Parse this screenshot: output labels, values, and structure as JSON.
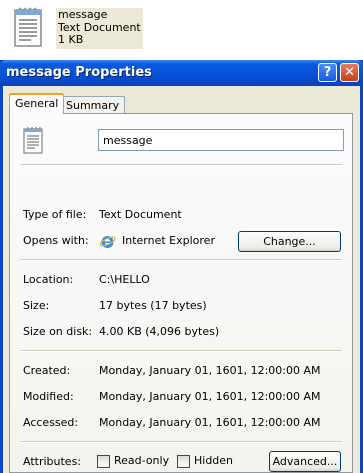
{
  "desktop_icon": {
    "name": "message",
    "type": "Text Document",
    "size": "1 KB"
  },
  "window": {
    "title": "message Properties",
    "help_button": "?",
    "close_button": "✕"
  },
  "tabs": [
    {
      "label": "General",
      "active": true
    },
    {
      "label": "Summary",
      "active": false
    }
  ],
  "general": {
    "file_name": "message",
    "type_of_file_label": "Type of file:",
    "type_of_file_value": "Text Document",
    "opens_with_label": "Opens with:",
    "opens_with_value": "Internet Explorer",
    "change_button": "Change...",
    "location_label": "Location:",
    "location_value": "C:\\HELLO",
    "size_label": "Size:",
    "size_value": "17 bytes (17 bytes)",
    "size_on_disk_label": "Size on disk:",
    "size_on_disk_value": "4.00 KB (4,096 bytes)",
    "created_label": "Created:",
    "created_value": "Monday, January 01, 1601, 12:00:00 AM",
    "modified_label": "Modified:",
    "modified_value": "Monday, January 01, 1601, 12:00:00 AM",
    "accessed_label": "Accessed:",
    "accessed_value": "Monday, January 01, 1601, 12:00:00 AM",
    "attributes_label": "Attributes:",
    "readonly_label": "Read-only",
    "hidden_label": "Hidden",
    "advanced_button": "Advanced..."
  },
  "icons": {
    "file": "text-document-icon",
    "ie": "internet-explorer-icon"
  },
  "colors": {
    "titlebar": "#0550d8",
    "dialog_face": "#ece9d8",
    "close_button": "#c8401c",
    "active_tab_accent": "#f0a030"
  }
}
